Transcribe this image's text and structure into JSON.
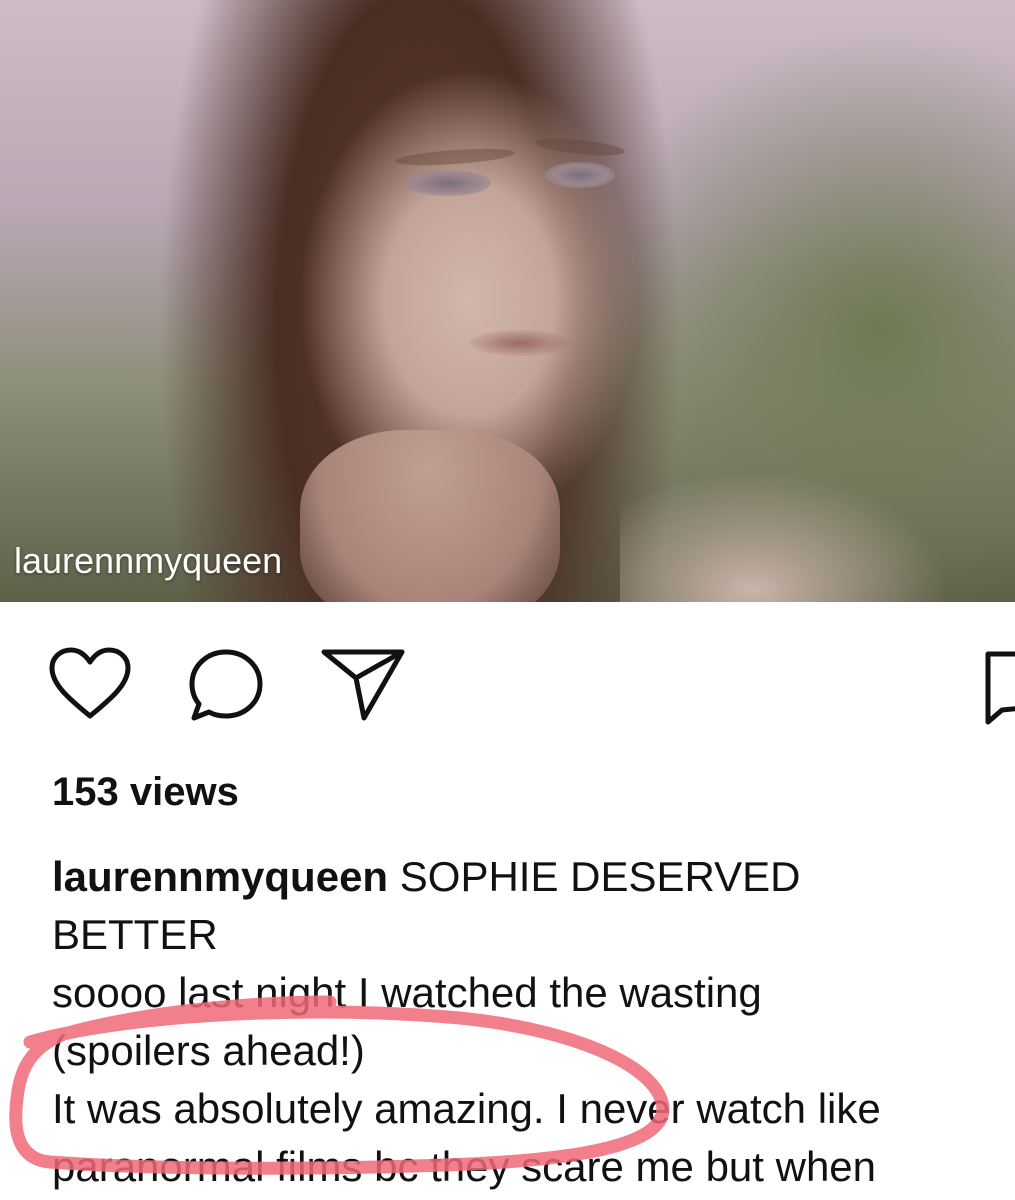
{
  "video": {
    "watermark": "laurennmyqueen"
  },
  "actions": {
    "like_icon": "heart-icon",
    "comment_icon": "comment-icon",
    "share_icon": "paper-plane-icon",
    "save_icon": "bookmark-icon"
  },
  "post": {
    "views": "153 views",
    "username": "laurennmyqueen",
    "caption_lines": [
      "SOPHIE DESERVED",
      "BETTER",
      "soooo last night I watched the wasting",
      "(spoilers ahead!)",
      "It was absolutely amazing. I never watch like",
      "paranormal films bc they scare me but when"
    ]
  },
  "annotation": {
    "color": "#f06a78"
  }
}
